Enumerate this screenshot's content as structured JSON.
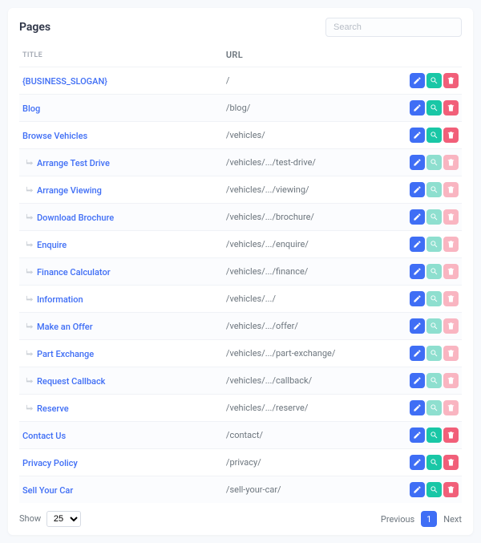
{
  "header": {
    "title": "Pages",
    "search_placeholder": "Search"
  },
  "table": {
    "columns": {
      "title": "TITLE",
      "url": "URL"
    },
    "rows": [
      {
        "title": "{BUSINESS_SLOGAN}",
        "url": "/",
        "indent": false,
        "view_muted": false,
        "del_muted": false
      },
      {
        "title": "Blog",
        "url": "/blog/",
        "indent": false,
        "view_muted": false,
        "del_muted": false
      },
      {
        "title": "Browse Vehicles",
        "url": "/vehicles/",
        "indent": false,
        "view_muted": false,
        "del_muted": false
      },
      {
        "title": "Arrange Test Drive",
        "url": "/vehicles/.../test-drive/",
        "indent": true,
        "view_muted": true,
        "del_muted": true
      },
      {
        "title": "Arrange Viewing",
        "url": "/vehicles/.../viewing/",
        "indent": true,
        "view_muted": true,
        "del_muted": true
      },
      {
        "title": "Download Brochure",
        "url": "/vehicles/.../brochure/",
        "indent": true,
        "view_muted": true,
        "del_muted": true
      },
      {
        "title": "Enquire",
        "url": "/vehicles/.../enquire/",
        "indent": true,
        "view_muted": true,
        "del_muted": true
      },
      {
        "title": "Finance Calculator",
        "url": "/vehicles/.../finance/",
        "indent": true,
        "view_muted": true,
        "del_muted": true
      },
      {
        "title": "Information",
        "url": "/vehicles/.../",
        "indent": true,
        "view_muted": true,
        "del_muted": true
      },
      {
        "title": "Make an Offer",
        "url": "/vehicles/.../offer/",
        "indent": true,
        "view_muted": true,
        "del_muted": true
      },
      {
        "title": "Part Exchange",
        "url": "/vehicles/.../part-exchange/",
        "indent": true,
        "view_muted": true,
        "del_muted": true
      },
      {
        "title": "Request Callback",
        "url": "/vehicles/.../callback/",
        "indent": true,
        "view_muted": true,
        "del_muted": true
      },
      {
        "title": "Reserve",
        "url": "/vehicles/.../reserve/",
        "indent": true,
        "view_muted": true,
        "del_muted": true
      },
      {
        "title": "Contact Us",
        "url": "/contact/",
        "indent": false,
        "view_muted": false,
        "del_muted": false
      },
      {
        "title": "Privacy Policy",
        "url": "/privacy/",
        "indent": false,
        "view_muted": false,
        "del_muted": false
      },
      {
        "title": "Sell Your Car",
        "url": "/sell-your-car/",
        "indent": false,
        "view_muted": false,
        "del_muted": false
      }
    ]
  },
  "footer": {
    "show_label": "Show",
    "page_size": "25",
    "prev_label": "Previous",
    "next_label": "Next",
    "current_page": "1"
  }
}
